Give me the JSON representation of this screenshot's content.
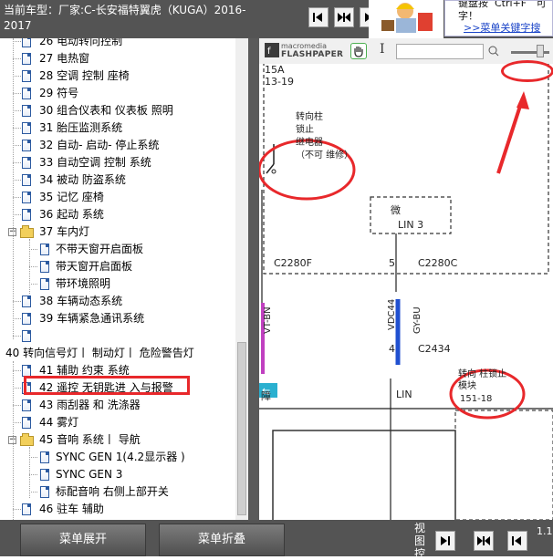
{
  "header": {
    "title": "当前车型：厂家:C-长安福特翼虎（KUGA）2016-2017",
    "tip_text": "键盘按  Ctrl+F   可\n字！",
    "tip_link": ">>菜单关键字搜"
  },
  "tree": {
    "items": [
      {
        "label": "26 电动转向控制",
        "kind": "doc"
      },
      {
        "label": "27 电热窗",
        "kind": "doc"
      },
      {
        "label": "28 空调 控制 座椅",
        "kind": "doc"
      },
      {
        "label": "29 符号",
        "kind": "doc"
      },
      {
        "label": "30 组合仪表和 仪表板 照明",
        "kind": "doc"
      },
      {
        "label": "31 胎压监测系统",
        "kind": "doc"
      },
      {
        "label": "32 自动- 启动- 停止系统",
        "kind": "doc"
      },
      {
        "label": "33 自动空调 控制 系统",
        "kind": "doc"
      },
      {
        "label": "34 被动 防盗系统",
        "kind": "doc"
      },
      {
        "label": "35 记忆 座椅",
        "kind": "doc"
      },
      {
        "label": "36 起动 系统",
        "kind": "doc"
      },
      {
        "label": "37 车内灯",
        "kind": "folder"
      },
      {
        "label": "不带天窗开启面板",
        "kind": "subdoc"
      },
      {
        "label": "带天窗开启面板",
        "kind": "subdoc"
      },
      {
        "label": "带环境照明",
        "kind": "subdoc"
      },
      {
        "label": "38 车辆动态系统",
        "kind": "doc"
      },
      {
        "label": "39 车辆紧急通讯系统",
        "kind": "doc"
      },
      {
        "label": "",
        "kind": "doc"
      },
      {
        "label": "40 转向信号灯丨 制动灯丨 危险警告灯",
        "kind": "plain"
      },
      {
        "label": "41 辅助 约束 系统",
        "kind": "doc"
      },
      {
        "label": "42 遥控 无钥匙进 入与报警",
        "kind": "doc"
      },
      {
        "label": "43 雨刮器 和 洗涤器",
        "kind": "doc"
      },
      {
        "label": "44 雾灯",
        "kind": "doc"
      },
      {
        "label": "45 音响 系统丨 导航",
        "kind": "folder"
      },
      {
        "label": "SYNC GEN 1(4.2显示器 )",
        "kind": "subdoc"
      },
      {
        "label": "SYNC GEN 3",
        "kind": "subdoc"
      },
      {
        "label": "标配音响 右侧上部开关",
        "kind": "subdoc"
      },
      {
        "label": "46 驻车 辅助",
        "kind": "doc"
      }
    ]
  },
  "viewer": {
    "logo_top": "macromedia",
    "logo_bottom": "FLASHPAPER",
    "schematic": {
      "fuse": "15A",
      "fuse_ref": "13-19",
      "steering_lock_note": "转向柱\n锁止\n继电器\n（不可 维修）",
      "module_abbr": "微",
      "lin3": "LIN 3",
      "c2280f": "C2280F",
      "pin5": "5",
      "c2280c": "C2280C",
      "wire_left": "VT-BN",
      "wire_mid": "VDC44",
      "wire_right": "GY-BU",
      "pin4": "4",
      "c2434": "C2434",
      "lin": "LIN",
      "partial_char": "障",
      "module_name": "转向 柱锁止\n模块",
      "module_ref": "151-18"
    }
  },
  "bottom": {
    "expand_label": "菜单展开",
    "collapse_label": "菜单折叠",
    "view_label": "视图控",
    "scale_label": "1.1"
  },
  "colors": {
    "bar_bg": "#545454",
    "annotation_red": "#e8282b",
    "wire_purple": "#c040c0",
    "wire_blue": "#2050d0"
  }
}
